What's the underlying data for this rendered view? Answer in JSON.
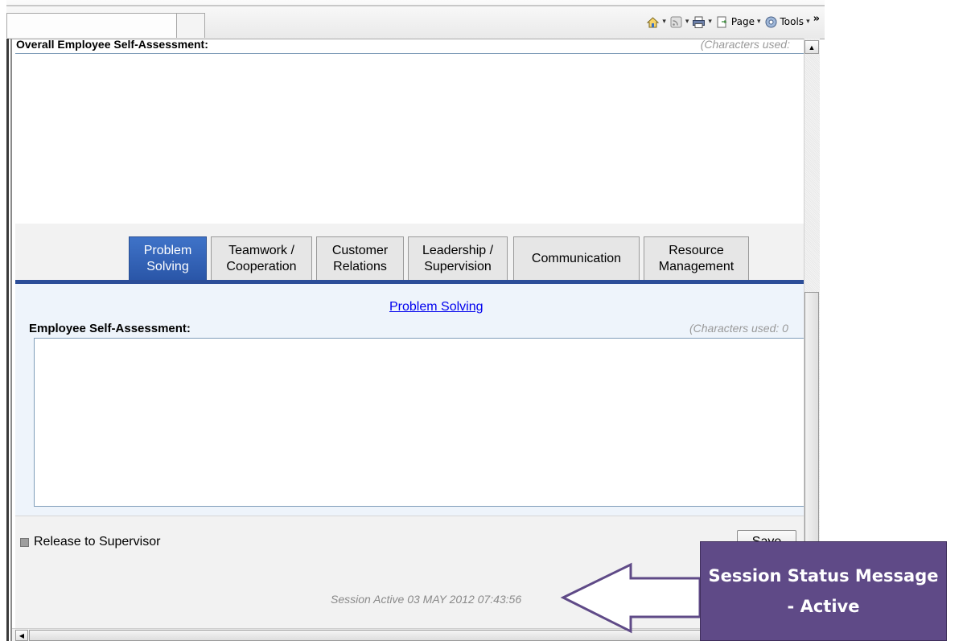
{
  "browser": {
    "commandbar": {
      "page_label": "Page",
      "tools_label": "Tools",
      "overflow_label": "»"
    }
  },
  "form": {
    "overall_label": "Overall Employee Self-Assessment:",
    "overall_chars": "(Characters used:",
    "tabs": [
      {
        "label": "Problem\nSolving",
        "active": true
      },
      {
        "label": "Teamwork /\nCooperation",
        "active": false
      },
      {
        "label": "Customer\nRelations",
        "active": false
      },
      {
        "label": "Leadership /\nSupervision",
        "active": false
      },
      {
        "label": "Communication",
        "active": false
      },
      {
        "label": "Resource\nManagement",
        "active": false
      }
    ],
    "section_link": "Problem Solving",
    "employee_label": "Employee Self-Assessment:",
    "employee_chars": "(Characters used: 0",
    "release_label": "Release to Supervisor",
    "save_label": "Save",
    "session_message": "Session Active 03 MAY 2012 07:43:56"
  },
  "annotation": {
    "line1": "Session Status Message",
    "line2": "- Active",
    "fill_color": "#5f4a87"
  },
  "colors": {
    "active_tab": "#2f5fb6",
    "tab_rule": "#2b4d98",
    "panel_bg": "#eef4fb",
    "link": "#0000ee"
  }
}
